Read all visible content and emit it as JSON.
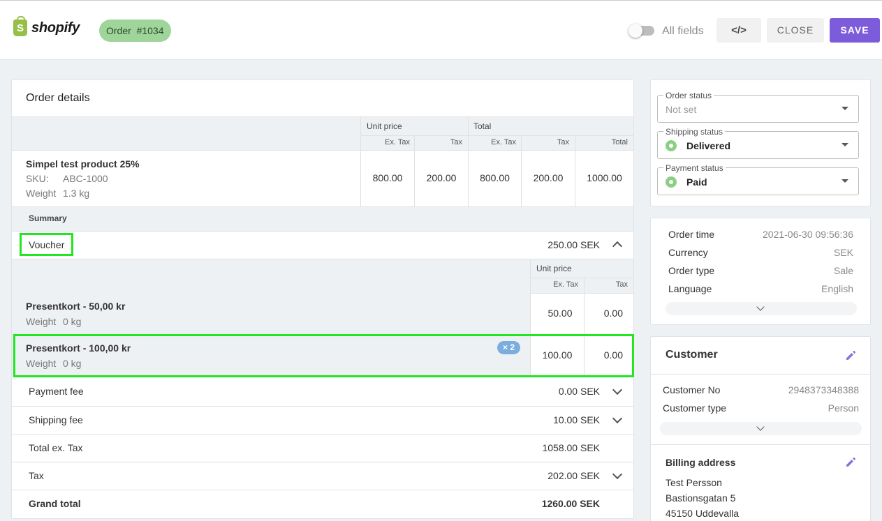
{
  "header": {
    "logo_text": "shopify",
    "logo_glyph": "S",
    "order_chip": "Order  #1034",
    "all_fields_label": "All fields",
    "code_button_label": "</>",
    "close_label": "CLOSE",
    "save_label": "SAVE"
  },
  "order_details": {
    "title": "Order details",
    "group_headers": {
      "unit_price": "Unit price",
      "total": "Total"
    },
    "sub_headers": {
      "ex_tax": "Ex. Tax",
      "tax": "Tax",
      "total": "Total"
    },
    "product": {
      "name": "Simpel test product 25%",
      "sku_label": "SKU:",
      "sku_value": "ABC-1000",
      "weight_label": "Weight",
      "weight_value": "1.3 kg",
      "unit_ex_tax": "800.00",
      "unit_tax": "200.00",
      "total_ex_tax": "800.00",
      "total_tax": "200.00",
      "total": "1000.00"
    },
    "summary_label": "Summary",
    "voucher": {
      "label": "Voucher",
      "amount": "250.00 SEK",
      "sub_header_unit_price": "Unit price",
      "sub_header_ex_tax": "Ex. Tax",
      "sub_header_tax": "Tax",
      "items": [
        {
          "name": "Presentkort - 50,00 kr",
          "weight_label": "Weight",
          "weight_value": "0 kg",
          "ex_tax": "50.00",
          "tax": "0.00",
          "qty": ""
        },
        {
          "name": "Presentkort - 100,00 kr",
          "weight_label": "Weight",
          "weight_value": "0 kg",
          "ex_tax": "100.00",
          "tax": "0.00",
          "qty": "× 2"
        }
      ]
    },
    "summary_rows": [
      {
        "label": "Payment fee",
        "value": "0.00 SEK"
      },
      {
        "label": "Shipping fee",
        "value": "10.00 SEK"
      },
      {
        "label": "Total ex. Tax",
        "value": "1058.00 SEK"
      },
      {
        "label": "Tax",
        "value": "202.00 SEK"
      },
      {
        "label": "Grand total",
        "value": "1260.00 SEK"
      }
    ]
  },
  "status_panel": {
    "order_status": {
      "label": "Order status",
      "value": "Not set"
    },
    "shipping_status": {
      "label": "Shipping status",
      "value": "Delivered"
    },
    "payment_status": {
      "label": "Payment status",
      "value": "Paid"
    }
  },
  "info_panel": {
    "rows": [
      {
        "key": "Order time",
        "value": "2021-06-30 09:56:36"
      },
      {
        "key": "Currency",
        "value": "SEK"
      },
      {
        "key": "Order type",
        "value": "Sale"
      },
      {
        "key": "Language",
        "value": "English"
      }
    ]
  },
  "customer_panel": {
    "title": "Customer",
    "rows": [
      {
        "key": "Customer No",
        "value": "2948373348388"
      },
      {
        "key": "Customer type",
        "value": "Person"
      }
    ],
    "billing_title": "Billing address",
    "billing_lines": [
      "Test Persson",
      "Bastionsgatan 5",
      "45150 Uddevalla"
    ]
  },
  "colors": {
    "accent": "#7c5cdb",
    "order_chip_bg": "#9fd49a",
    "status_green": "#8ccf84",
    "highlight_box": "#22e622",
    "qty_badge": "#7aaede"
  }
}
